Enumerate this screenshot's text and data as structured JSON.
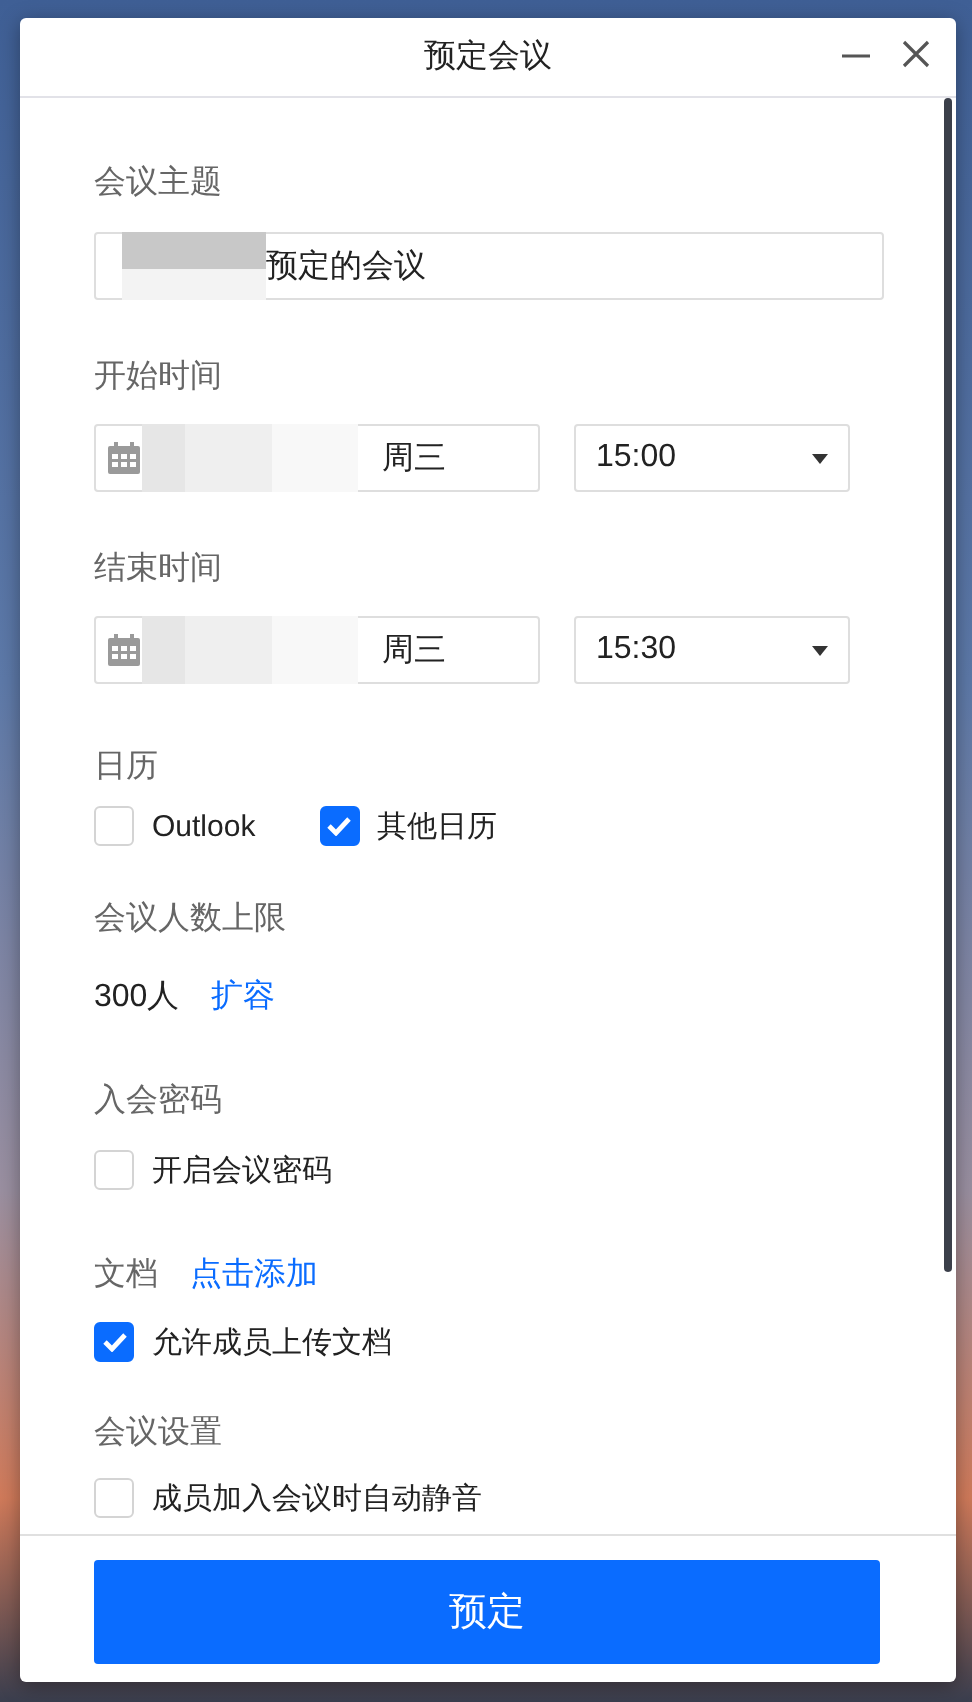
{
  "window": {
    "title": "预定会议"
  },
  "subject": {
    "label": "会议主题",
    "value": "预定的会议"
  },
  "start": {
    "label": "开始时间",
    "weekday": "周三",
    "time": "15:00"
  },
  "end": {
    "label": "结束时间",
    "weekday": "周三",
    "time": "15:30"
  },
  "calendar": {
    "label": "日历",
    "options": [
      {
        "label": "Outlook",
        "checked": false
      },
      {
        "label": "其他日历",
        "checked": true
      }
    ]
  },
  "capacity": {
    "label": "会议人数上限",
    "value": "300人",
    "link": "扩容"
  },
  "password": {
    "label": "入会密码",
    "options": [
      {
        "label": "开启会议密码",
        "checked": false
      }
    ]
  },
  "documents": {
    "label": "文档",
    "link": "点击添加",
    "options": [
      {
        "label": "允许成员上传文档",
        "checked": true
      }
    ]
  },
  "settings": {
    "label": "会议设置",
    "options": [
      {
        "label": "成员加入会议时自动静音",
        "checked": false
      }
    ]
  },
  "submit": "预定"
}
